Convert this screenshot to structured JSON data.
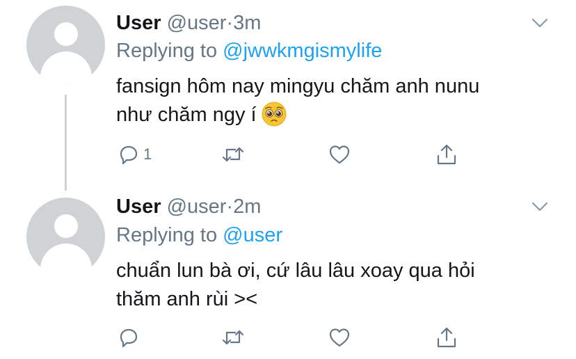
{
  "tweets": [
    {
      "name": "User",
      "handle": "@user",
      "time_separator": "·",
      "time": "3m",
      "replying_prefix": "Replying to",
      "replying_to": "@jwwkmgismylife",
      "text_line1": "fansign hôm nay mingyu chăm anh nunu",
      "text_line2": "như chăm ngy í",
      "emoji": "pleading-face-emoji",
      "reply_count": "1"
    },
    {
      "name": "User",
      "handle": "@user",
      "time_separator": "·",
      "time": "2m",
      "replying_prefix": "Replying to",
      "replying_to": "@user",
      "text_line1": "chuẩn lun bà ơi, cứ lâu lâu xoay qua hỏi",
      "text_line2": "thăm anh rùi ><",
      "reply_count": ""
    }
  ],
  "icons": {
    "reply": "reply-icon",
    "retweet": "retweet-icon",
    "like": "heart-icon",
    "share": "share-icon",
    "more": "chevron-down-icon"
  },
  "colors": {
    "link": "#1da1f2",
    "secondary_text": "#657786",
    "primary_text": "#14171a",
    "avatar_bg": "#cfd3d6"
  }
}
